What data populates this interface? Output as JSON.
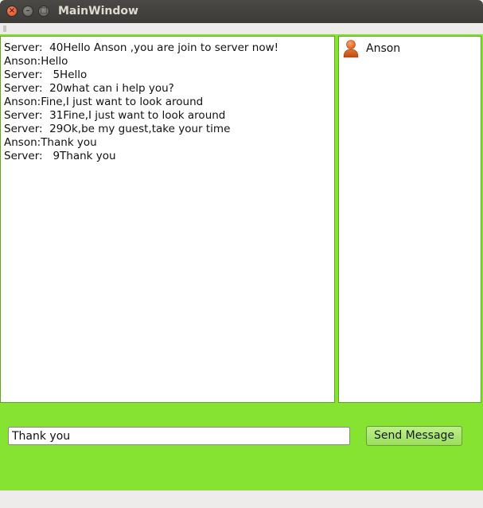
{
  "window": {
    "title": "MainWindow",
    "controls": {
      "close_icon": "close-icon",
      "minimize_icon": "minimize-icon",
      "maximize_icon": "maximize-icon"
    }
  },
  "chat": {
    "lines": [
      "Server:  40Hello Anson ,you are join to server now!",
      "Anson:Hello",
      "Server:   5Hello",
      "Server:  20what can i help you?",
      "Anson:Fine,I just want to look around",
      "Server:  31Fine,I just want to look around",
      "Server:  29Ok,be my guest,take your time",
      "Anson:Thank you",
      "Server:   9Thank you"
    ]
  },
  "users": {
    "items": [
      {
        "name": "Anson",
        "icon": "user-icon"
      }
    ]
  },
  "compose": {
    "input_value": "Thank you",
    "send_label": "Send Message"
  },
  "colors": {
    "central_background": "#87e332",
    "titlebar": "#3c3b37",
    "close_button": "#df4a16"
  }
}
